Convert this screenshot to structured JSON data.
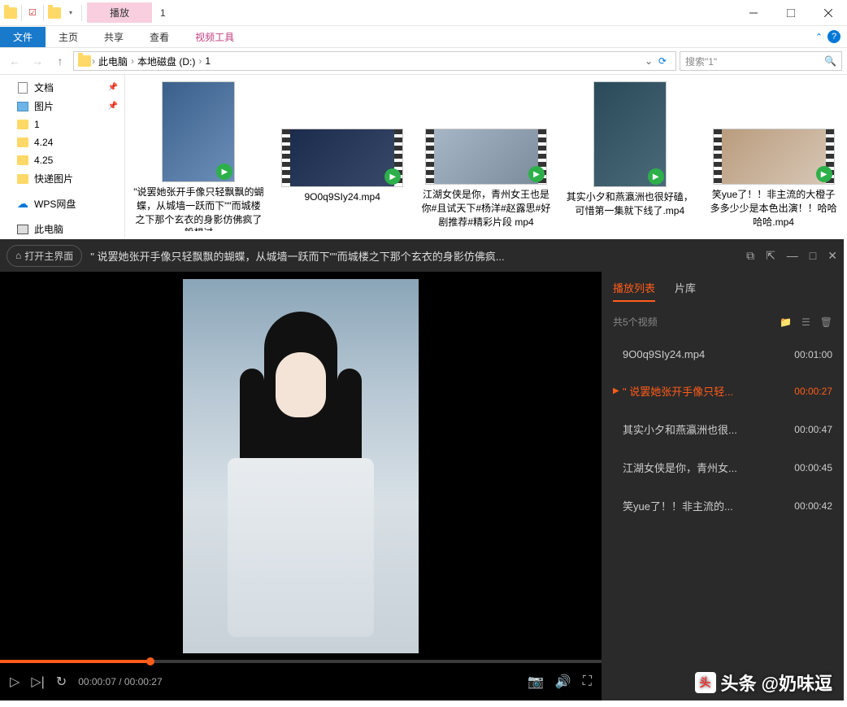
{
  "titlebar": {
    "play_tab": "播放",
    "folder_name": "1"
  },
  "ribbon": {
    "file": "文件",
    "home": "主页",
    "share": "共享",
    "view": "查看",
    "video_tools": "视频工具"
  },
  "breadcrumb": {
    "seg1": "此电脑",
    "seg2": "本地磁盘 (D:)",
    "seg3": "1"
  },
  "search": {
    "placeholder": "搜索\"1\""
  },
  "sidebar": {
    "docs": "文档",
    "pics": "图片",
    "f1": "1",
    "f2": "4.24",
    "f3": "4.25",
    "f4": "快递图片",
    "wps": "WPS网盘",
    "pc": "此电脑"
  },
  "files": [
    {
      "name": "\"说罢她张开手像只轻飘飘的蝴蝶，从城墙一跃而下\"\"而城楼之下那个玄衣的身影仿佛疯了般想过"
    },
    {
      "name": "9O0q9SIy24.mp4"
    },
    {
      "name": "江湖女侠是你，青州女王也是你#且试天下#杨洋#赵露思#好剧推荐#精彩片段 mp4"
    },
    {
      "name": "其实小夕和燕瀛洲也很好磕，可惜第一集就下线了.mp4"
    },
    {
      "name": "笑yue了！！非主流的大橙子多多少少是本色出演！！哈哈哈哈.mp4"
    }
  ],
  "player": {
    "open_main": "打开主界面",
    "title": "\" 说罢她张开手像只轻飘飘的蝴蝶，从城墙一跃而下\"\"而城楼之下那个玄衣的身影仿佛疯...",
    "time_current": "00:00:07",
    "time_total": "00:00:27"
  },
  "playlist": {
    "tab_list": "播放列表",
    "tab_lib": "片库",
    "count": "共5个视频",
    "items": [
      {
        "name": "9O0q9SIy24.mp4",
        "dur": "00:01:00",
        "active": false
      },
      {
        "name": "\" 说罢她张开手像只轻...",
        "dur": "00:00:27",
        "active": true
      },
      {
        "name": "其实小夕和燕瀛洲也很...",
        "dur": "00:00:47",
        "active": false
      },
      {
        "name": "江湖女侠是你，青州女...",
        "dur": "00:00:45",
        "active": false
      },
      {
        "name": "笑yue了！！非主流的...",
        "dur": "00:00:42",
        "active": false
      }
    ]
  },
  "watermark": {
    "brand": "头条",
    "user": "@奶味逗"
  }
}
